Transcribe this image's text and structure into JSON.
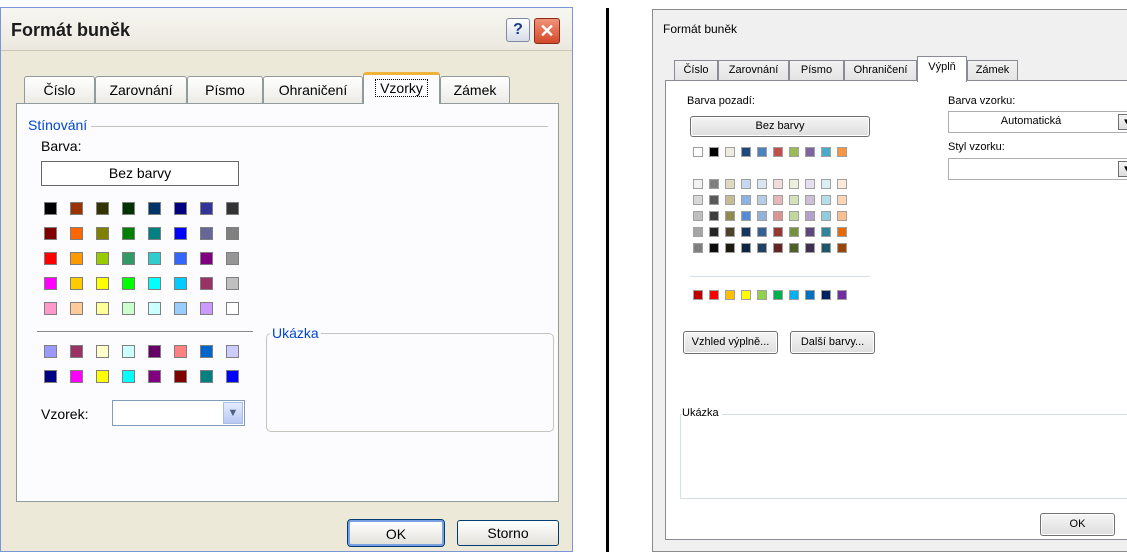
{
  "left_dialog": {
    "title": "Formát buněk",
    "help_label": "?",
    "close_label": "✕",
    "tabs": [
      "Číslo",
      "Zarovnání",
      "Písmo",
      "Ohraničení",
      "Vzorky",
      "Zámek"
    ],
    "active_tab": "Vzorky",
    "shading_group": "Stínování",
    "color_label": "Barva:",
    "no_color_label": "Bez barvy",
    "palette_main": [
      [
        "#000000",
        "#993300",
        "#333300",
        "#003300",
        "#003366",
        "#000080",
        "#333399",
        "#333333"
      ],
      [
        "#800000",
        "#FF6600",
        "#808000",
        "#008000",
        "#008080",
        "#0000FF",
        "#666699",
        "#808080"
      ],
      [
        "#FF0000",
        "#FF9900",
        "#99CC00",
        "#339966",
        "#33CCCC",
        "#3366FF",
        "#800080",
        "#969696"
      ],
      [
        "#FF00FF",
        "#FFCC00",
        "#FFFF00",
        "#00FF00",
        "#00FFFF",
        "#00CCFF",
        "#993366",
        "#C0C0C0"
      ],
      [
        "#FF99CC",
        "#FFCC99",
        "#FFFF99",
        "#CCFFCC",
        "#CCFFFF",
        "#99CCFF",
        "#CC99FF",
        "#FFFFFF"
      ]
    ],
    "palette_extra": [
      [
        "#9999FF",
        "#993366",
        "#FFFFCC",
        "#CCFFFF",
        "#660066",
        "#FF8080",
        "#0066CC",
        "#CCCCFF"
      ],
      [
        "#000080",
        "#FF00FF",
        "#FFFF00",
        "#00FFFF",
        "#800080",
        "#800000",
        "#008080",
        "#0000FF"
      ]
    ],
    "preview_label": "Ukázka",
    "pattern_label": "Vzorek:",
    "ok_label": "OK",
    "cancel_label": "Storno"
  },
  "right_dialog": {
    "title": "Formát buněk",
    "tabs": [
      "Číslo",
      "Zarovnání",
      "Písmo",
      "Ohraničení",
      "Výplň",
      "Zámek"
    ],
    "active_tab": "Výplň",
    "background_color_label": "Barva pozadí:",
    "no_color_label": "Bez barvy",
    "theme_row": [
      "#FFFFFF",
      "#000000",
      "#EEECE1",
      "#1F497D",
      "#4F81BD",
      "#C0504D",
      "#9BBB59",
      "#8064A2",
      "#4BACC6",
      "#F79646"
    ],
    "theme_shades": [
      [
        "#F2F2F2",
        "#7F7F7F",
        "#DDD9C3",
        "#C6D9F0",
        "#DBE5F1",
        "#F2DCDB",
        "#EBF1DD",
        "#E5E0EC",
        "#DBEEF3",
        "#FDEADA"
      ],
      [
        "#D8D8D8",
        "#595959",
        "#C4BD97",
        "#8DB3E2",
        "#B8CCE4",
        "#E5B9B7",
        "#D7E3BC",
        "#CCC1D9",
        "#B7DDE8",
        "#FBD5B5"
      ],
      [
        "#BFBFBF",
        "#3F3F3F",
        "#938953",
        "#548DD4",
        "#95B3D7",
        "#D99694",
        "#C3D69B",
        "#B2A2C7",
        "#92CDDC",
        "#FAC08F"
      ],
      [
        "#A5A5A5",
        "#262626",
        "#494429",
        "#17365D",
        "#366092",
        "#953734",
        "#76923C",
        "#5F497A",
        "#31859B",
        "#E36C09"
      ],
      [
        "#7F7F7F",
        "#0C0C0C",
        "#1D1B10",
        "#0F243E",
        "#244061",
        "#632423",
        "#4F6128",
        "#3F3151",
        "#205867",
        "#974806"
      ]
    ],
    "standard_row": [
      "#C00000",
      "#FF0000",
      "#FFC000",
      "#FFFF00",
      "#92D050",
      "#00B050",
      "#00B0F0",
      "#0070C0",
      "#002060",
      "#7030A0"
    ],
    "fill_effects_label": "Vzhled výplně...",
    "more_colors_label": "Další barvy...",
    "pattern_color_label": "Barva vzorku:",
    "pattern_color_value": "Automatická",
    "pattern_style_label": "Styl vzorku:",
    "pattern_style_value": "",
    "preview_label": "Ukázka",
    "ok_label": "OK"
  }
}
